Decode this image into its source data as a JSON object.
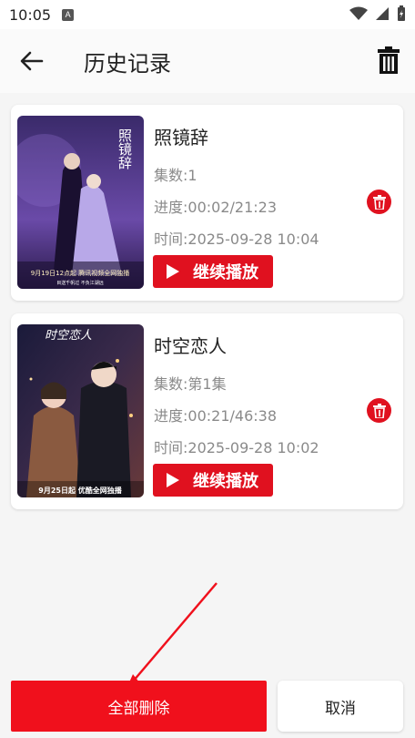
{
  "status_bar": {
    "time": "10:05",
    "notif_letter": "A"
  },
  "app_bar": {
    "title": "历史记录"
  },
  "items": [
    {
      "title": "照镜辞",
      "episodes": "集数:1",
      "progress": "进度:00:02/21:23",
      "time": "时间:2025-09-28 10:04",
      "resume_label": "继续播放",
      "poster": {
        "colors": [
          "#3a2a6a",
          "#8a6ac8"
        ],
        "title_art": "照镜辞",
        "tagline": "9月19日12点起 腾讯视频全网独播",
        "subline": "目送千帆过 不负江湖远"
      }
    },
    {
      "title": "时空恋人",
      "episodes": "集数:第1集",
      "progress": "进度:00:21/46:38",
      "time": "时间:2025-09-28 10:02",
      "resume_label": "继续播放",
      "poster": {
        "colors": [
          "#1a1a3a",
          "#5a3a4a"
        ],
        "title_art": "时空恋人",
        "tagline": "9月25日起 优酷全网独播"
      }
    }
  ],
  "bottom": {
    "delete_all": "全部删除",
    "cancel": "取消"
  },
  "colors": {
    "accent": "#e0111f"
  }
}
